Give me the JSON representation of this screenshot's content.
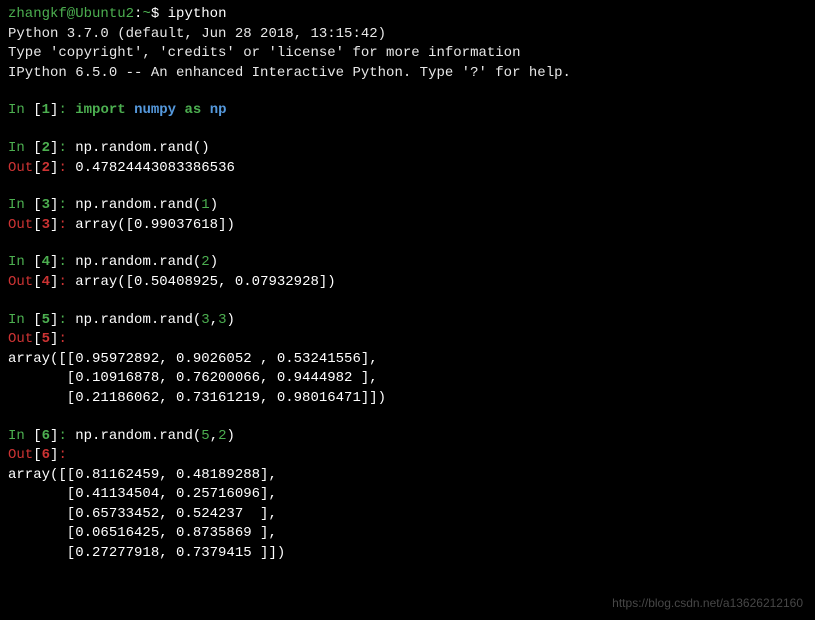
{
  "shell_prompt": {
    "user": "zhangkf@Ubuntu2",
    "sep": ":",
    "path": "~",
    "dollar": "$",
    "command": "ipython"
  },
  "header": {
    "line1": "Python 3.7.0 (default, Jun 28 2018, 13:15:42)",
    "line2": "Type 'copyright', 'credits' or 'license' for more information",
    "line3": "IPython 6.5.0 -- An enhanced Interactive Python. Type '?' for help."
  },
  "cells": {
    "c1": {
      "in_num": "1",
      "import": "import",
      "module": "numpy",
      "as": "as",
      "alias": "np"
    },
    "c2": {
      "in_num": "2",
      "code": "np.random.rand()",
      "out_num": "2",
      "output": "0.47824443083386536"
    },
    "c3": {
      "in_num": "3",
      "code_pre": "np.random.rand(",
      "arg": "1",
      "code_post": ")",
      "out_num": "3",
      "output": "array([0.99037618])"
    },
    "c4": {
      "in_num": "4",
      "code_pre": "np.random.rand(",
      "arg": "2",
      "code_post": ")",
      "out_num": "4",
      "output": "array([0.50408925, 0.07932928])"
    },
    "c5": {
      "in_num": "5",
      "code_pre": "np.random.rand(",
      "arg1": "3",
      "comma": ",",
      "arg2": "3",
      "code_post": ")",
      "out_num": "5",
      "output_l1": "array([[0.95972892, 0.9026052 , 0.53241556],",
      "output_l2": "       [0.10916878, 0.76200066, 0.9444982 ],",
      "output_l3": "       [0.21186062, 0.73161219, 0.98016471]])"
    },
    "c6": {
      "in_num": "6",
      "code_pre": "np.random.rand(",
      "arg1": "5",
      "comma": ",",
      "arg2": "2",
      "code_post": ")",
      "out_num": "6",
      "output_l1": "array([[0.81162459, 0.48189288],",
      "output_l2": "       [0.41134504, 0.25716096],",
      "output_l3": "       [0.65733452, 0.524237  ],",
      "output_l4": "       [0.06516425, 0.8735869 ],",
      "output_l5": "       [0.27277918, 0.7379415 ]])"
    }
  },
  "labels": {
    "in": "In ",
    "out": "Out",
    "colon": ": "
  },
  "watermark": "https://blog.csdn.net/a13626212160"
}
